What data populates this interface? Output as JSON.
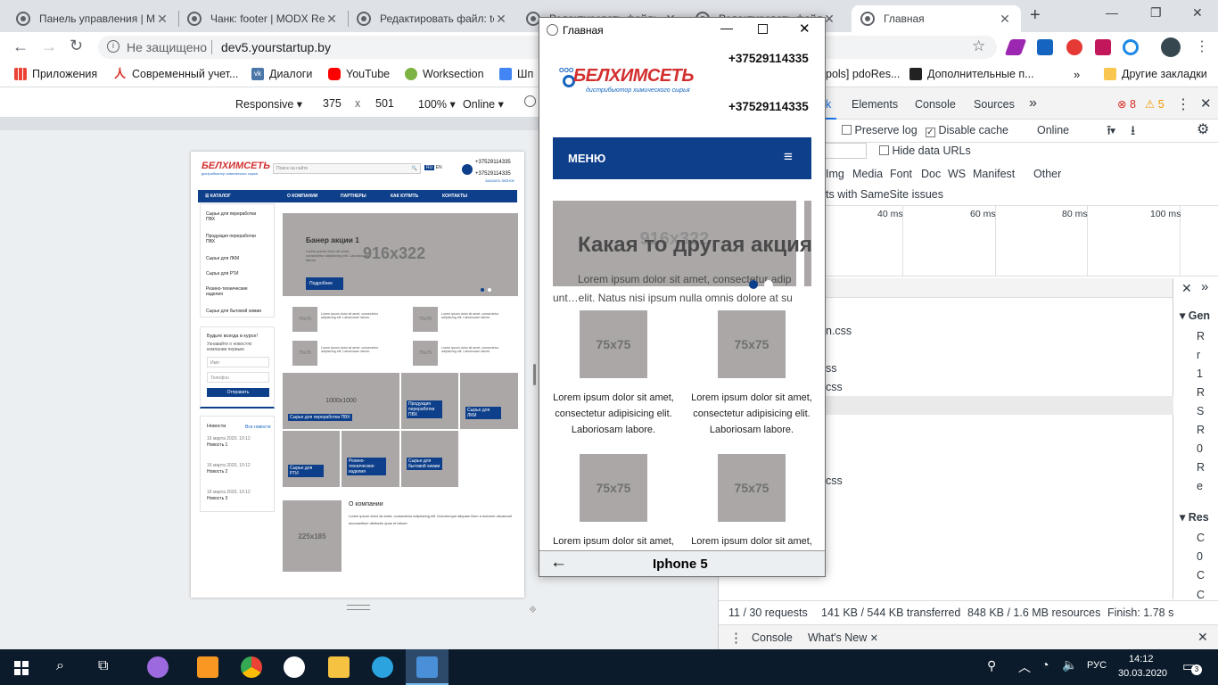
{
  "browser": {
    "tabs": [
      {
        "title": "Панель управления | MODX Revolution",
        "active": false
      },
      {
        "title": "Чанк: footer | MODX Revolution",
        "active": false
      },
      {
        "title": "Редактировать файл: template",
        "active": false
      },
      {
        "title": "Редактировать файл:",
        "active": false
      },
      {
        "title": "Редактировать файл:",
        "active": false
      },
      {
        "title": "Главная",
        "active": true
      }
    ],
    "address": {
      "security": "Не защищено",
      "url": "dev5.yourstartup.by"
    },
    "bookmarks": [
      {
        "label": "Приложения",
        "icon": "apps-icon",
        "color": "#ea4335"
      },
      {
        "label": "Современный учет...",
        "icon": "bookmark-icon",
        "color": "#d93025"
      },
      {
        "label": "Диалоги",
        "icon": "vk-icon",
        "color": "#4a76a8"
      },
      {
        "label": "YouTube",
        "icon": "youtube-icon",
        "color": "#ff0000"
      },
      {
        "label": "Worksection",
        "icon": "play-icon",
        "color": "#7cb342"
      },
      {
        "label": "Шп",
        "icon": "doc-icon",
        "color": "#4285f4"
      }
    ],
    "bookmarks_right": {
      "partial": "pols] pdoRes...",
      "extra": "Дополнительные п...",
      "other": "Другие закладки"
    }
  },
  "device_toolbar": {
    "mode": "Responsive",
    "width": "375",
    "times": "x",
    "height": "501",
    "zoom": "100%",
    "network": "Online"
  },
  "mini_site": {
    "phone1": "+37529114335",
    "phone2": "+37529114335",
    "callback": "ЗАКАЗАТЬ ЗВОНОК",
    "search_placeholder": "Поиск на сайте",
    "lang": "EN",
    "nav": [
      "КАТАЛОГ",
      "О КОМПАНИИ",
      "ПАРТНЕРЫ",
      "КАК КУПИТЬ",
      "КОНТАКТЫ"
    ],
    "sidebar": [
      "Сырье для переработки ПВХ",
      "Продукция переработки ПВХ",
      "Сырье для ЛКМ",
      "Сырье для РТИ",
      "Резино-технические изделия",
      "Сырье для бытовой химии"
    ],
    "subscribe_title": "Будьте всегда в курсе!",
    "subscribe_text": "Узнавайте о новостях компании первым",
    "name_ph": "Имя",
    "phone_ph": "Телефон",
    "send": "Отправить",
    "news_title": "Новости",
    "news_all": "Все новости",
    "news": [
      {
        "date": "16 марта 2020, 10:12",
        "title": "Новость 1"
      },
      {
        "date": "16 марта 2020, 10:12",
        "title": "Новость 2"
      },
      {
        "date": "16 марта 2020, 10:12",
        "title": "Новость 3"
      }
    ],
    "banner_title": "Банер акции 1",
    "banner_size": "916x322",
    "banner_button": "Подробнее",
    "thumb": "75x75",
    "thumb_text": "Lorem ipsum dolor sit amet, consectetur adipisicing elit. Laboriosam labore.",
    "cat_big": "1000x1000",
    "categories": [
      "Сырье для переработки ПВХ",
      "Продукция переработки ПВХ",
      "Сырье для ЛКМ",
      "Сырье для РТИ",
      "Резино-технические изделия",
      "Сырье для бытовой химии"
    ],
    "about_img": "225x185",
    "about_title": "О компании",
    "about_text": "Lorem ipsum dolor sit amet, consectetur adipisicing elit. Doloremque aliquam illum a dolorem obcaecati accusantium distinctio quos et labore."
  },
  "popup": {
    "window_title": "Главная",
    "logo_ooo": "ООО",
    "logo_text": "БЕЛХИМСЕТЬ",
    "logo_tagline": "дистрибьютор химического сырья",
    "phone1": "+37529114335",
    "phone2": "+37529114335",
    "menu": "МЕНЮ",
    "slider_size": "916x322",
    "slide_title": "Какая то другая акция",
    "slide_text1": "Lorem ipsum dolor sit amet, consectetur adip",
    "slide_text2": "unt…elit. Natus nisi ipsum nulla omnis dolore at su",
    "thumb": "75x75",
    "thumb_text": "Lorem ipsum dolor sit amet, consectetur adipisicing elit. Laboriosam labore.",
    "thumb_text_short": "Lorem ipsum dolor sit amet, consectetur",
    "device": "Iphone 5",
    "back_arrow": "←"
  },
  "devtools": {
    "tabs": [
      "k",
      "Elements",
      "Console",
      "Sources",
      "»"
    ],
    "errors": "8",
    "warnings": "5",
    "preserve_log": "Preserve log",
    "disable_cache": "Disable cache",
    "throttle": "Online",
    "hide_data_urls": "Hide data URLs",
    "filters": [
      "Img",
      "Media",
      "Font",
      "Doc",
      "WS",
      "Manifest",
      "Other"
    ],
    "samesite": "ts with SameSite issues",
    "timeline": [
      "40 ms",
      "60 ms",
      "80 ms",
      "100 ms"
    ],
    "files": [
      "n.css",
      "ss",
      "css",
      "css"
    ],
    "side_letters": [
      "R",
      "r",
      "1",
      "R",
      "S",
      "R",
      "0",
      "R",
      "e"
    ],
    "side_letters2": [
      "C",
      "0",
      "C",
      "C"
    ],
    "side_header1": "Gen",
    "side_header2": "Res",
    "status": {
      "requests": "11 / 30 requests",
      "transferred": "141 KB / 544 KB transferred",
      "resources": "848 KB / 1.6 MB resources",
      "finish": "Finish: 1.78 s"
    },
    "drawer": {
      "console": "Console",
      "whatsnew": "What's New"
    }
  },
  "taskbar": {
    "lang": "РУС",
    "time": "14:12",
    "date": "30.03.2020",
    "notifications": "3"
  }
}
